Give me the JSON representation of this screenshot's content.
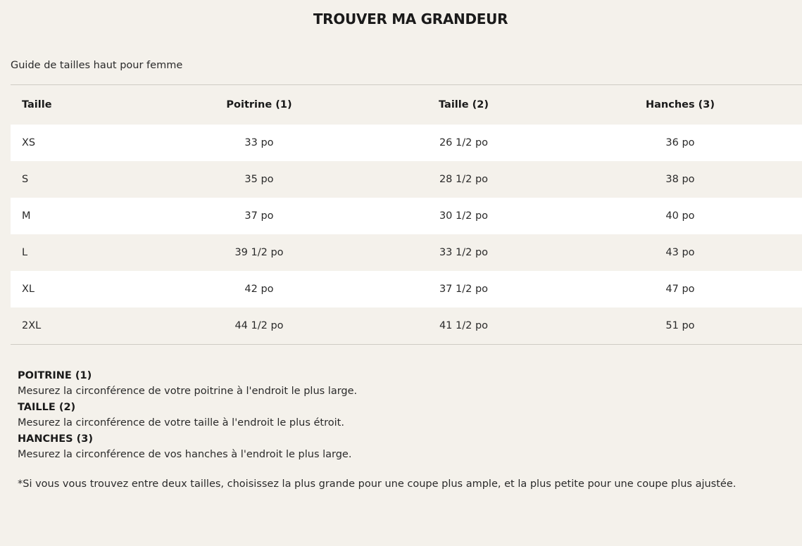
{
  "page": {
    "title": "TROUVER MA GRANDEUR",
    "subtitle": "Guide de tailles haut pour femme"
  },
  "table": {
    "headers": [
      "Taille",
      "Poitrine (1)",
      "Taille (2)",
      "Hanches (3)"
    ],
    "rows": [
      [
        "XS",
        "33 po",
        "26 1/2 po",
        "36 po"
      ],
      [
        "S",
        "35 po",
        "28 1/2 po",
        "38 po"
      ],
      [
        "M",
        "37 po",
        "30 1/2 po",
        "40 po"
      ],
      [
        "L",
        "39 1/2 po",
        "33 1/2 po",
        "43 po"
      ],
      [
        "XL",
        "42 po",
        "37 1/2 po",
        "47 po"
      ],
      [
        "2XL",
        "44 1/2 po",
        "41 1/2 po",
        "51 po"
      ]
    ]
  },
  "notes": [
    {
      "label": "POITRINE (1)",
      "text": "Mesurez la circonférence de votre poitrine à l'endroit le plus large."
    },
    {
      "label": "TAILLE (2)",
      "text": "Mesurez la circonférence de votre taille à l'endroit le plus étroit."
    },
    {
      "label": "HANCHES (3)",
      "text": "Mesurez la circonférence de vos hanches à l'endroit le plus large."
    }
  ],
  "footnote": "*Si vous vous trouvez entre deux tailles, choisissez la plus grande pour une coupe plus ample, et la plus petite pour une coupe plus ajustée.",
  "colors": {
    "background": "#f4f1eb",
    "row_highlight": "#ffffff",
    "text": "#1a1a1a"
  }
}
